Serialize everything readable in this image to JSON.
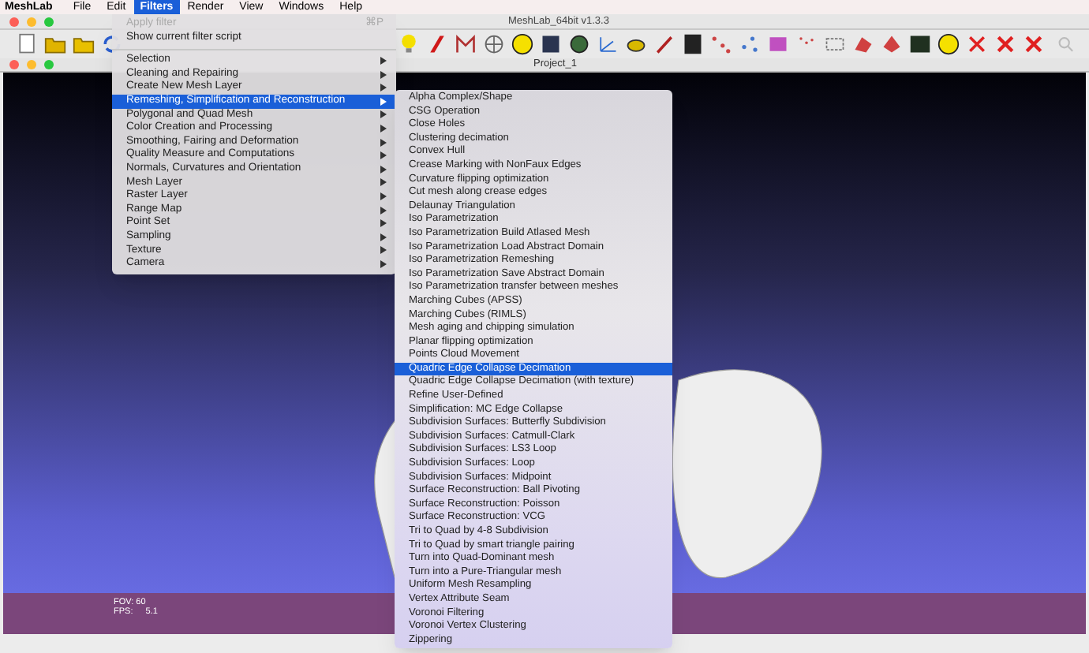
{
  "menubar": {
    "app": "MeshLab",
    "items": [
      {
        "label": "File",
        "selected": false
      },
      {
        "label": "Edit",
        "selected": false
      },
      {
        "label": "Filters",
        "selected": true
      },
      {
        "label": "Render",
        "selected": false
      },
      {
        "label": "View",
        "selected": false
      },
      {
        "label": "Windows",
        "selected": false
      },
      {
        "label": "Help",
        "selected": false
      }
    ]
  },
  "window": {
    "title": "MeshLab_64bit v1.3.3"
  },
  "project": {
    "title": "Project_1"
  },
  "viewport": {
    "fov": "FOV: 60",
    "fps_label": "FPS:",
    "fps": "5.1"
  },
  "filters_menu": {
    "items": [
      {
        "kind": "action",
        "label": "Apply filter",
        "shortcut": "⌘P",
        "disabled": true
      },
      {
        "kind": "action",
        "label": "Show current filter script",
        "disabled": false
      },
      {
        "kind": "separator"
      },
      {
        "kind": "submenu",
        "label": "Selection",
        "selected": false
      },
      {
        "kind": "submenu",
        "label": "Cleaning and Repairing",
        "selected": false
      },
      {
        "kind": "submenu",
        "label": "Create New Mesh Layer",
        "selected": false
      },
      {
        "kind": "submenu",
        "label": "Remeshing, Simplification and Reconstruction",
        "selected": true
      },
      {
        "kind": "submenu",
        "label": "Polygonal and Quad Mesh",
        "selected": false
      },
      {
        "kind": "submenu",
        "label": "Color Creation and Processing",
        "selected": false
      },
      {
        "kind": "submenu",
        "label": "Smoothing, Fairing and Deformation",
        "selected": false
      },
      {
        "kind": "submenu",
        "label": "Quality Measure and Computations",
        "selected": false
      },
      {
        "kind": "submenu",
        "label": "Normals, Curvatures and Orientation",
        "selected": false
      },
      {
        "kind": "submenu",
        "label": "Mesh Layer",
        "selected": false
      },
      {
        "kind": "submenu",
        "label": "Raster Layer",
        "selected": false
      },
      {
        "kind": "submenu",
        "label": "Range Map",
        "selected": false
      },
      {
        "kind": "submenu",
        "label": "Point Set",
        "selected": false
      },
      {
        "kind": "submenu",
        "label": "Sampling",
        "selected": false
      },
      {
        "kind": "submenu",
        "label": "Texture",
        "selected": false
      },
      {
        "kind": "submenu",
        "label": "Camera",
        "selected": false
      }
    ]
  },
  "submenu": {
    "items": [
      {
        "label": "Alpha Complex/Shape",
        "selected": false
      },
      {
        "label": "CSG Operation",
        "selected": false
      },
      {
        "label": "Close Holes",
        "selected": false
      },
      {
        "label": "Clustering decimation",
        "selected": false
      },
      {
        "label": "Convex Hull",
        "selected": false
      },
      {
        "label": "Crease Marking with NonFaux Edges",
        "selected": false
      },
      {
        "label": "Curvature flipping optimization",
        "selected": false
      },
      {
        "label": "Cut mesh along crease edges",
        "selected": false
      },
      {
        "label": "Delaunay Triangulation",
        "selected": false
      },
      {
        "label": "Iso Parametrization",
        "selected": false
      },
      {
        "label": "Iso Parametrization Build Atlased Mesh",
        "selected": false
      },
      {
        "label": "Iso Parametrization Load Abstract Domain",
        "selected": false
      },
      {
        "label": "Iso Parametrization Remeshing",
        "selected": false
      },
      {
        "label": "Iso Parametrization Save Abstract Domain",
        "selected": false
      },
      {
        "label": "Iso Parametrization transfer between meshes",
        "selected": false
      },
      {
        "label": "Marching Cubes (APSS)",
        "selected": false
      },
      {
        "label": "Marching Cubes (RIMLS)",
        "selected": false
      },
      {
        "label": "Mesh aging and chipping simulation",
        "selected": false
      },
      {
        "label": "Planar flipping optimization",
        "selected": false
      },
      {
        "label": "Points Cloud Movement",
        "selected": false
      },
      {
        "label": "Quadric Edge Collapse Decimation",
        "selected": true
      },
      {
        "label": "Quadric Edge Collapse Decimation (with texture)",
        "selected": false
      },
      {
        "label": "Refine User-Defined",
        "selected": false
      },
      {
        "label": "Simplification: MC Edge Collapse",
        "selected": false
      },
      {
        "label": "Subdivision Surfaces: Butterfly Subdivision",
        "selected": false
      },
      {
        "label": "Subdivision Surfaces: Catmull-Clark",
        "selected": false
      },
      {
        "label": "Subdivision Surfaces: LS3 Loop",
        "selected": false
      },
      {
        "label": "Subdivision Surfaces: Loop",
        "selected": false
      },
      {
        "label": "Subdivision Surfaces: Midpoint",
        "selected": false
      },
      {
        "label": "Surface Reconstruction: Ball Pivoting",
        "selected": false
      },
      {
        "label": "Surface Reconstruction: Poisson",
        "selected": false
      },
      {
        "label": "Surface Reconstruction: VCG",
        "selected": false
      },
      {
        "label": "Tri to Quad by 4-8 Subdivision",
        "selected": false
      },
      {
        "label": "Tri to Quad by smart triangle pairing",
        "selected": false
      },
      {
        "label": "Turn into Quad-Dominant mesh",
        "selected": false
      },
      {
        "label": "Turn into a Pure-Triangular mesh",
        "selected": false
      },
      {
        "label": "Uniform Mesh Resampling",
        "selected": false
      },
      {
        "label": "Vertex Attribute Seam",
        "selected": false
      },
      {
        "label": "Voronoi Filtering",
        "selected": false
      },
      {
        "label": "Voronoi Vertex Clustering",
        "selected": false
      },
      {
        "label": "Zippering",
        "selected": false
      }
    ]
  }
}
